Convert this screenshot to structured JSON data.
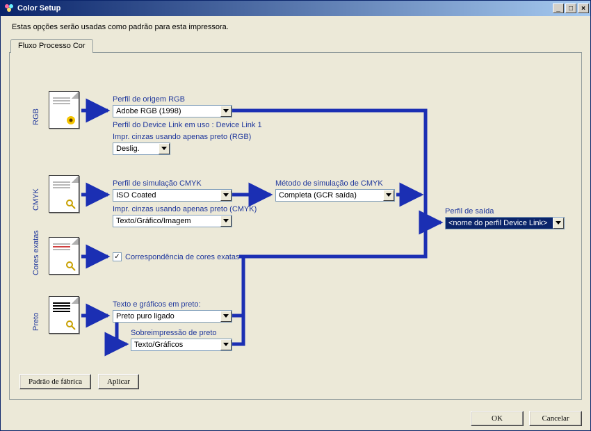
{
  "window": {
    "title": "Color Setup"
  },
  "intro": "Estas opções serão usadas como padrão para esta impressora.",
  "tab": {
    "label": "Fluxo Processo Cor"
  },
  "sections": {
    "rgb": "RGB",
    "cmyk": "CMYK",
    "spot": "Cores exatas",
    "black": "Preto"
  },
  "labels": {
    "rgb_source": "Perfil de origem RGB",
    "device_link_info": "Perfil do Device Link em uso : Device Link 1",
    "rgb_gray": "Impr. cinzas usando apenas preto (RGB)",
    "cmyk_sim": "Perfil de simulação CMYK",
    "cmyk_method": "Método de simulação de CMYK",
    "cmyk_gray": "Impr. cinzas usando apenas preto (CMYK)",
    "spot_match": "Correspondência de cores exatas",
    "black_text": "Texto e gráficos em preto:",
    "black_over": "Sobreimpressão de preto",
    "output_profile": "Perfil de saída"
  },
  "values": {
    "rgb_source": "Adobe RGB (1998)",
    "rgb_gray": "Deslig.",
    "cmyk_sim": "ISO Coated",
    "cmyk_method": "Completa (GCR saída)",
    "cmyk_gray": "Texto/Gráfico/Imagem",
    "spot_checked": "✓",
    "black_text": "Preto puro ligado",
    "black_over": "Texto/Gráficos",
    "output_profile": "<nome do perfil Device Link>"
  },
  "buttons": {
    "factory": "Padrão de fábrica",
    "apply": "Aplicar",
    "ok": "OK",
    "cancel": "Cancelar"
  }
}
